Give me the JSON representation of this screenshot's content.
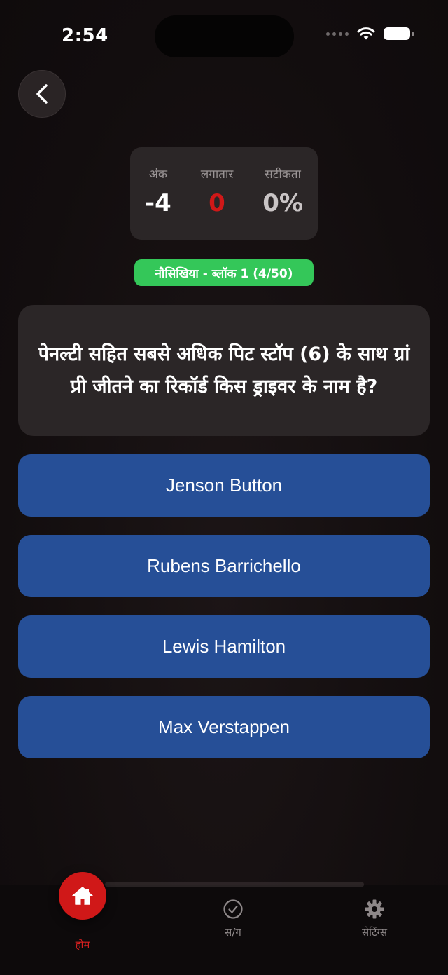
{
  "status_bar": {
    "time": "2:54"
  },
  "stats": {
    "score": {
      "label": "अंक",
      "value": "-4",
      "color": "#ffffff"
    },
    "streak": {
      "label": "लगातार",
      "value": "0",
      "color": "#d01818"
    },
    "accuracy": {
      "label": "सटीकता",
      "value": "0%",
      "color": "#c9c4c5"
    }
  },
  "level_badge": {
    "text": "नौसिखिया - ब्लॉक 1 (4/50)",
    "color": "#34c759"
  },
  "question": {
    "text": "पेनल्टी सहित सबसे अधिक पिट स्टॉप (6) के साथ ग्रां प्री जीतने का रिकॉर्ड किस ड्राइवर के नाम है?"
  },
  "answers": [
    {
      "label": "Jenson Button"
    },
    {
      "label": "Rubens Barrichello"
    },
    {
      "label": "Lewis Hamilton"
    },
    {
      "label": "Max Verstappen"
    }
  ],
  "answer_color": "#264f97",
  "tab_bar": {
    "home": {
      "label": "होम",
      "icon": "house-icon",
      "active": true
    },
    "qa": {
      "label": "स/ग",
      "icon": "check-circle-icon",
      "active": false
    },
    "settings": {
      "label": "सेटिंग्स",
      "icon": "gear-icon",
      "active": false
    }
  },
  "accent_color": "#d01818"
}
